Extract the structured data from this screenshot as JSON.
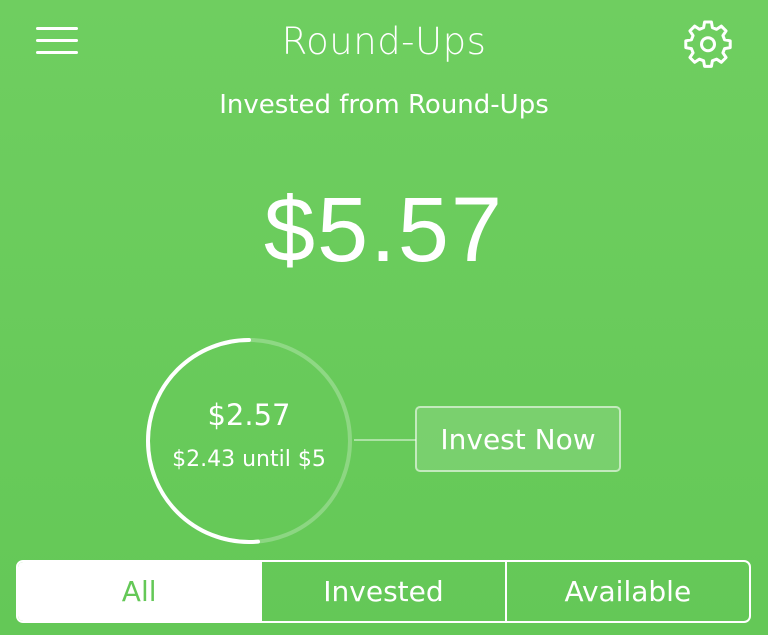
{
  "header": {
    "title": "Round-Ups",
    "menu_icon": "hamburger-menu-icon",
    "settings_icon": "gear-icon"
  },
  "summary": {
    "subtitle": "Invested from Round-Ups",
    "total_invested": "$5.57"
  },
  "pending": {
    "amount": "$2.57",
    "remaining_text": "$2.43 until $5",
    "progress_fraction": 0.514
  },
  "actions": {
    "invest_now_label": "Invest Now"
  },
  "filter": {
    "tabs": [
      {
        "label": "All",
        "active": true
      },
      {
        "label": "Invested",
        "active": false
      },
      {
        "label": "Available",
        "active": false
      }
    ]
  },
  "colors": {
    "background": "#6fce60",
    "accent_text": "#64c857",
    "foreground": "#ffffff"
  }
}
